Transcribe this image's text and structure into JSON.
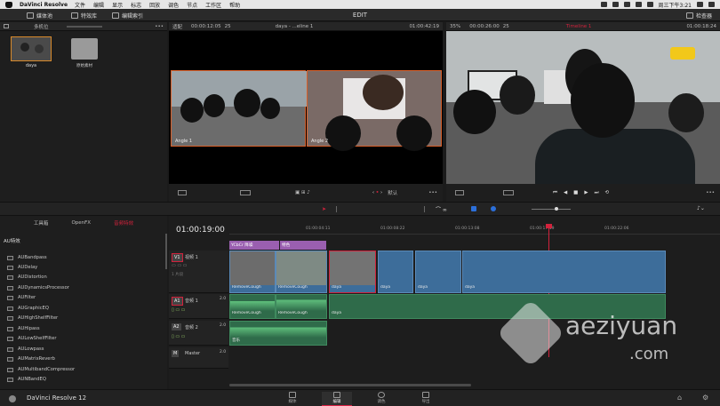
{
  "menubar": {
    "app_name": "DaVinci Resolve",
    "items": [
      "文件",
      "编辑",
      "显示",
      "标志",
      "回放",
      "调色",
      "节点",
      "工作区",
      "帮助"
    ],
    "clock": "周三下午3:21"
  },
  "toolbar": {
    "media_pool": "媒体池",
    "effects_library": "特效库",
    "edit_index": "编辑索引",
    "page_title": "EDIT",
    "inspector": "检查器"
  },
  "media_pool": {
    "folder": "多机位",
    "clips": [
      {
        "name": "daya"
      },
      {
        "name": "原始素材"
      }
    ]
  },
  "source_viewer": {
    "zoom": "适配",
    "timecode_left": "00:00:12:05",
    "frame": "25",
    "title": "daya - ...eline 1",
    "timecode_right": "01:00:42:19",
    "angles": [
      "Angle 1",
      "Angle 2"
    ],
    "default_label": "默认"
  },
  "timeline_viewer": {
    "zoom": "35%",
    "timecode_left": "00:00:26:00",
    "frame": "25",
    "title": "Timeline 1",
    "timecode_right": "01:00:18:24"
  },
  "effects": {
    "tabs": [
      "工具箱",
      "OpenFX",
      "音频特效"
    ],
    "active_tab": "音频特效",
    "section": "AU特效",
    "items": [
      "AUBandpass",
      "AUDelay",
      "AUDistortion",
      "AUDynamicsProcessor",
      "AUFilter",
      "AUGraphicEQ",
      "AUHighShelfFilter",
      "AUHipass",
      "AULowShelfFilter",
      "AULowpass",
      "AUMatrixReverb",
      "AUMultibandCompressor",
      "AUNBandEQ"
    ]
  },
  "timeline": {
    "timecode": "01:00:19:00",
    "ruler": [
      "01:00:04:11",
      "01:00:08:22",
      "01:00:13:08",
      "01:00:17:19",
      "01:00:22:06"
    ],
    "tracks": {
      "v1": {
        "id": "V1",
        "name": "视频 1",
        "info": "1 片段"
      },
      "a1": {
        "id": "A1",
        "name": "音频 1",
        "level": "2.0"
      },
      "a2": {
        "id": "A2",
        "name": "音频 2",
        "level": "2.0"
      },
      "master": {
        "id": "M",
        "name": "Master",
        "level": "2.0"
      }
    },
    "v1_headers": [
      {
        "label": "YCbCr 降噪"
      },
      {
        "label": "特色"
      }
    ],
    "v1_clips": [
      {
        "label": "RemoveCough"
      },
      {
        "label": "RemoveCough"
      },
      {
        "label": "daya"
      },
      {
        "label": "daya"
      },
      {
        "label": "daya"
      },
      {
        "label": "daya"
      }
    ],
    "a1_clips": [
      {
        "label": "RemoveCough"
      },
      {
        "label": "RemoveCough"
      },
      {
        "label": "daya"
      }
    ],
    "a2_clip": "音乐"
  },
  "bottom": {
    "app_label": "DaVinci Resolve 12",
    "pages": [
      "媒体",
      "编辑",
      "调色",
      "导出"
    ],
    "active_page": "编辑"
  },
  "watermark": {
    "line1": "aeziyuan",
    "line2": ".com"
  },
  "colors": {
    "accent_red": "#d2223c",
    "video_clip": "#3d6d9a",
    "audio_clip": "#2f6b4a",
    "fx_header": "#9a5fb0"
  }
}
